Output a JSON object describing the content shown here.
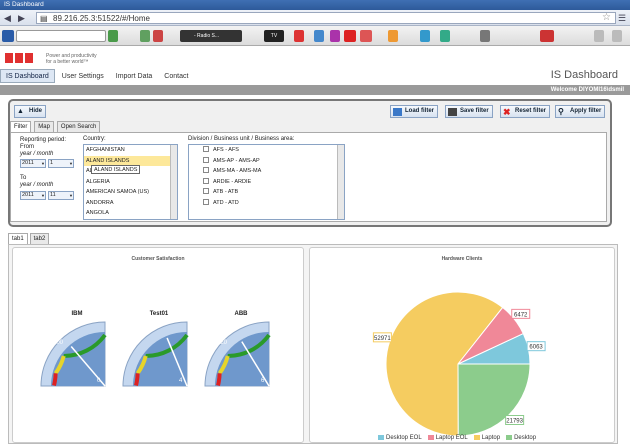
{
  "browser": {
    "title": "IS Dashboard",
    "url": "89.216.25.3:51522/#/Home",
    "toolbar": {
      "search_placeholder": "",
      "radio_label": "- Radio S..."
    }
  },
  "header": {
    "tagline_line1": "Power and productivity",
    "tagline_line2": "for a better world™",
    "nav": [
      "IS Dashboard",
      "User Settings",
      "Import Data",
      "Contact"
    ],
    "app_title": "IS Dashboard",
    "welcome": "Welcome DIYOMI16\\dsmil"
  },
  "actions": {
    "hide": "Hide",
    "load": "Load filter",
    "save": "Save filter",
    "reset": "Reset filter",
    "apply": "Apply filter"
  },
  "filter": {
    "tabs": [
      "Filter",
      "Map",
      "Open Search"
    ],
    "period_label": "Reporting period:",
    "from_label": "From",
    "from_hint": "year / month",
    "from_year": "2011",
    "from_month": "1",
    "to_label": "To",
    "to_hint": "year / month",
    "to_year": "2011",
    "to_month": "11",
    "country_label": "Country:",
    "countries": [
      "AFGHANISTAN",
      "ALAND ISLANDS",
      "AL",
      "ALGERIA",
      "AMERICAN SAMOA (US)",
      "ANDORRA",
      "ANGOLA"
    ],
    "country_tooltip": "ALAND ISLANDS",
    "division_label": "Division / Business unit / Business area:",
    "divisions": [
      "AFS - AFS",
      "AMS-AP - AMS-AP",
      "AMS-MA - AMS-MA",
      "ARDIE - ARDIE",
      "ATB - ATB",
      "ATD - ATD"
    ]
  },
  "dashboard": {
    "tabs": [
      "tab1",
      "tab2"
    ],
    "left_title": "Customer Satisfaction",
    "gauges": [
      {
        "name": "IBM",
        "value": 5.5,
        "ticks": [
          "100",
          "0"
        ]
      },
      {
        "name": "Test01",
        "value": 7.5,
        "ticks": [
          "5",
          "4"
        ]
      },
      {
        "name": "ABB",
        "value": 6.5,
        "ticks": [
          "120",
          "6"
        ]
      }
    ],
    "right_title": "Hardware Clients"
  },
  "chart_data": {
    "type": "pie",
    "title": "Hardware Clients",
    "categories": [
      "Desktop EOL",
      "Laptop EOL",
      "Laptop",
      "Desktop"
    ],
    "values": [
      6063,
      6472,
      52971,
      21793
    ],
    "colors": [
      "#7ec8dc",
      "#f08898",
      "#f5cc60",
      "#8ccc8c"
    ],
    "legend": "bottom"
  }
}
